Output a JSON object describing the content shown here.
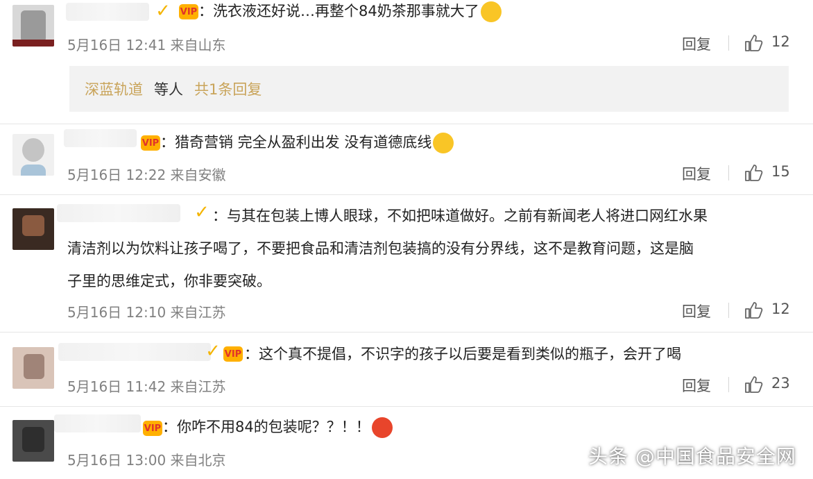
{
  "comments": [
    {
      "text": "：洗衣液还好说…再整个84奶茶那事就大了",
      "date": "5月16日",
      "time": "12:41",
      "location": "来自山东",
      "reply_label": "回复",
      "likes": "12",
      "subreply": {
        "user": "深蓝轨道",
        "middle": "等人",
        "count": "共1条回复"
      }
    },
    {
      "text": "：猎奇营销 完全从盈利出发 没有道德底线",
      "date": "5月16日",
      "time": "12:22",
      "location": "来自安徽",
      "reply_label": "回复",
      "likes": "15"
    },
    {
      "text_lines": [
        "：与其在包装上博人眼球，不如把味道做好。之前有新闻老人将进口网红水果",
        "清洁剂以为饮料让孩子喝了，不要把食品和清洁剂包装搞的没有分界线，这不是教育问题，这是脑",
        "子里的思维定式，你非要突破。"
      ],
      "date": "5月16日",
      "time": "12:10",
      "location": "来自江苏",
      "reply_label": "回复",
      "likes": "12"
    },
    {
      "text": "：这个真不提倡，不识字的孩子以后要是看到类似的瓶子，会开了喝",
      "date": "5月16日",
      "time": "11:42",
      "location": "来自江苏",
      "reply_label": "回复",
      "likes": "23"
    },
    {
      "text": "：你咋不用84的包装呢？？！！",
      "date": "5月16日",
      "time": "13:00",
      "location": "来自北京"
    }
  ],
  "watermark": "头条 @中国食品安全网",
  "colors": {
    "meta": "#808080",
    "link": "#c9a45a",
    "badge_gold": "#f4b400",
    "box": "#f2f2f2"
  }
}
